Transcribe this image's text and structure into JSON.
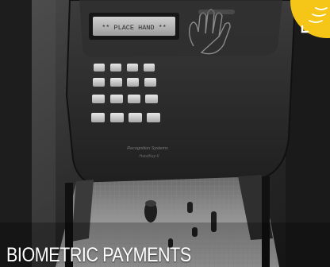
{
  "card": {
    "caption": "BIOMETRIC PAYMENTS",
    "device": {
      "display_text": "** PLACE HAND **",
      "brand_line_1": "Recognition Systems",
      "brand_line_2": "HandKey-II"
    },
    "badge": {
      "icon": "corner-logo-icon",
      "color": "#F5C518"
    }
  }
}
